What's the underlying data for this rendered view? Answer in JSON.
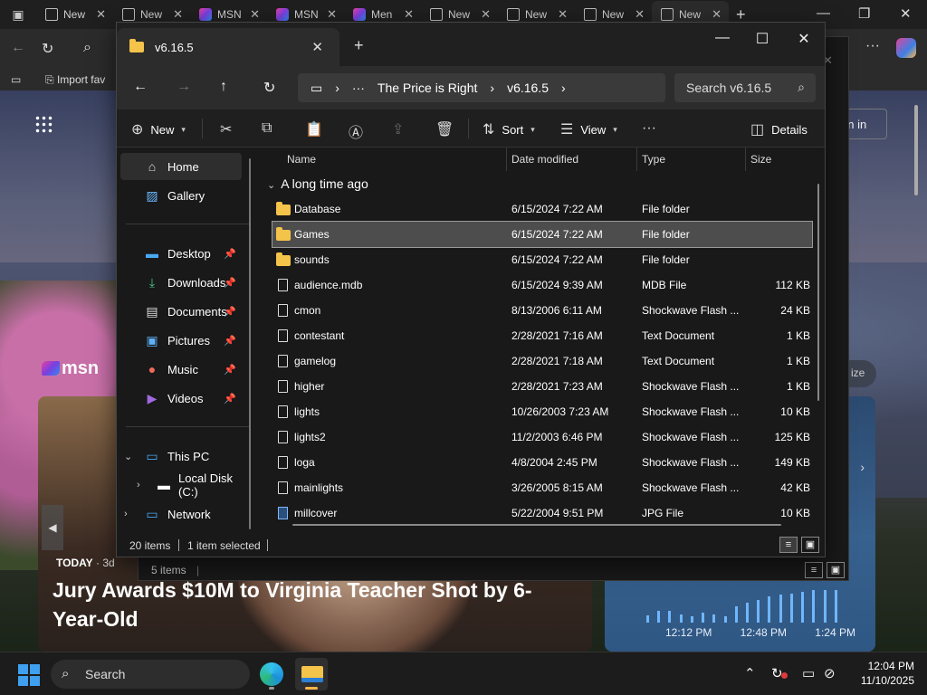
{
  "browser": {
    "tabs": [
      {
        "label": "New",
        "icon": "page-icon"
      },
      {
        "label": "New",
        "icon": "page-icon"
      },
      {
        "label": "MSN",
        "icon": "msn-icon"
      },
      {
        "label": "MSN",
        "icon": "msn-icon"
      },
      {
        "label": "Men",
        "icon": "msn-icon"
      },
      {
        "label": "New",
        "icon": "page-icon"
      },
      {
        "label": "New",
        "icon": "page-icon"
      },
      {
        "label": "New",
        "icon": "page-icon"
      },
      {
        "label": "New",
        "icon": "page-icon"
      }
    ],
    "import_favorites": "Import fav",
    "sign_in": "gn in",
    "msn_brand": "msn",
    "news": {
      "source": "TODAY",
      "age": "· 3d",
      "headline": "Jury Awards $10M to Virginia Teacher Shot by 6-Year-Old"
    },
    "weather": {
      "times": [
        "12:12 PM",
        "12:48 PM",
        "1:24 PM"
      ],
      "bars": [
        0.22,
        0.35,
        0.35,
        0.25,
        0.2,
        0.3,
        0.25,
        0.2,
        0.5,
        0.6,
        0.7,
        0.8,
        0.85,
        0.9,
        0.95,
        1.0,
        1.0,
        1.0
      ]
    },
    "peek_texts": [
      "KB",
      "KB",
      "KB",
      "KB",
      "KB",
      "ize"
    ]
  },
  "explorer_back": {
    "status": "5 items"
  },
  "explorer": {
    "tab_title": "v6.16.5",
    "breadcrumb": [
      "The Price is Right",
      "v6.16.5"
    ],
    "search_placeholder": "Search v6.16.5",
    "commands": {
      "new": "New",
      "sort": "Sort",
      "view": "View",
      "details": "Details"
    },
    "nav": {
      "home": "Home",
      "gallery": "Gallery",
      "desktop": "Desktop",
      "downloads": "Downloads",
      "documents": "Documents",
      "pictures": "Pictures",
      "music": "Music",
      "videos": "Videos",
      "this_pc": "This PC",
      "local_disk": "Local Disk (C:)",
      "network": "Network"
    },
    "columns": {
      "name": "Name",
      "date": "Date modified",
      "type": "Type",
      "size": "Size"
    },
    "group_title": "A long time ago",
    "files": [
      {
        "name": "Database",
        "date": "6/15/2024 7:22 AM",
        "type": "File folder",
        "size": "",
        "kind": "folder"
      },
      {
        "name": "Games",
        "date": "6/15/2024 7:22 AM",
        "type": "File folder",
        "size": "",
        "kind": "folder"
      },
      {
        "name": "sounds",
        "date": "6/15/2024 7:22 AM",
        "type": "File folder",
        "size": "",
        "kind": "folder"
      },
      {
        "name": "audience.mdb",
        "date": "6/15/2024 9:39 AM",
        "type": "MDB File",
        "size": "112 KB",
        "kind": "file"
      },
      {
        "name": "cmon",
        "date": "8/13/2006 6:11 AM",
        "type": "Shockwave Flash ...",
        "size": "24 KB",
        "kind": "file"
      },
      {
        "name": "contestant",
        "date": "2/28/2021 7:16 AM",
        "type": "Text Document",
        "size": "1 KB",
        "kind": "file"
      },
      {
        "name": "gamelog",
        "date": "2/28/2021 7:18 AM",
        "type": "Text Document",
        "size": "1 KB",
        "kind": "file"
      },
      {
        "name": "higher",
        "date": "2/28/2021 7:23 AM",
        "type": "Shockwave Flash ...",
        "size": "1 KB",
        "kind": "file"
      },
      {
        "name": "lights",
        "date": "10/26/2003 7:23 AM",
        "type": "Shockwave Flash ...",
        "size": "10 KB",
        "kind": "file"
      },
      {
        "name": "lights2",
        "date": "11/2/2003 6:46 PM",
        "type": "Shockwave Flash ...",
        "size": "125 KB",
        "kind": "file"
      },
      {
        "name": "loga",
        "date": "4/8/2004 2:45 PM",
        "type": "Shockwave Flash ...",
        "size": "149 KB",
        "kind": "file"
      },
      {
        "name": "mainlights",
        "date": "3/26/2005 8:15 AM",
        "type": "Shockwave Flash ...",
        "size": "42 KB",
        "kind": "file"
      },
      {
        "name": "millcover",
        "date": "5/22/2004 9:51 PM",
        "type": "JPG File",
        "size": "10 KB",
        "kind": "image"
      }
    ],
    "selected_index": 1,
    "status_items": "20 items",
    "status_selected": "1 item selected"
  },
  "taskbar": {
    "search_label": "Search",
    "time": "12:04 PM",
    "date": "11/10/2025"
  },
  "colors": {
    "accent_blue": "#3fa0f0",
    "folder_yellow": "#f4c34a",
    "selection_bg": "#4d4d4d"
  }
}
